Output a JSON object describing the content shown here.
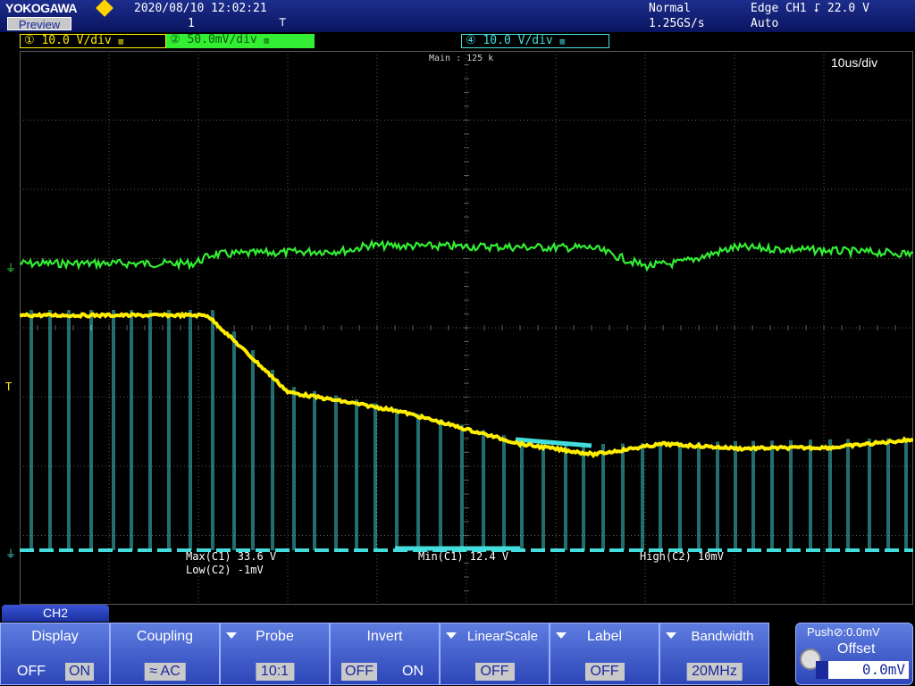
{
  "topbar": {
    "brand": "YOKOGAWA",
    "preview": "Preview",
    "datetime": "2020/08/10 12:02:21",
    "acq_count": "1",
    "acq_mode": "Normal",
    "sample_rate": "1.25GS/s",
    "trigger": "Edge CH1 ⮦ 22.0 V",
    "trigger_mode": "Auto"
  },
  "channels": [
    {
      "num": "①",
      "scale": "10.0 V∕div",
      "color": "#ffee00",
      "style": "outline"
    },
    {
      "num": "②",
      "scale": "50.0mV∕div",
      "color": "#33ee33",
      "style": "filled"
    },
    {
      "num": "④",
      "scale": "10.0 V∕div",
      "color": "#44dddd",
      "style": "outline"
    }
  ],
  "screen": {
    "main_record": "Main : 125 k",
    "timebase": "10us/div",
    "trigger_level_marker": "T"
  },
  "measurements": {
    "max_c1": "Max(C1)  33.6 V",
    "low_c2": "Low(C2)  -1mV",
    "min_c1": "Min(C1)  12.4 V",
    "high_c2": "High(C2)  10mV"
  },
  "menu": {
    "tab": "CH2",
    "display": {
      "label": "Display",
      "off": "OFF",
      "on": "ON",
      "selected": "ON"
    },
    "coupling": {
      "label": "Coupling",
      "value": "≈ AC"
    },
    "probe": {
      "label": "Probe",
      "value": "10:1"
    },
    "invert": {
      "label": "Invert",
      "off": "OFF",
      "on": "ON",
      "selected": "OFF"
    },
    "linear_scale": {
      "label": "LinearScale",
      "value": "OFF"
    },
    "label_btn": {
      "label": "Label",
      "value": "OFF"
    },
    "bandwidth": {
      "label": "Bandwidth",
      "value": "20MHz"
    },
    "offset": {
      "push": "Push⊘:0.0mV",
      "label": "Offset",
      "value": "0.0mV"
    }
  },
  "colors": {
    "ch1": "#ffee00",
    "ch2": "#33ee33",
    "ch4": "#44dddd",
    "grid": "#5a5a5a",
    "accent": "#2d46b8"
  }
}
